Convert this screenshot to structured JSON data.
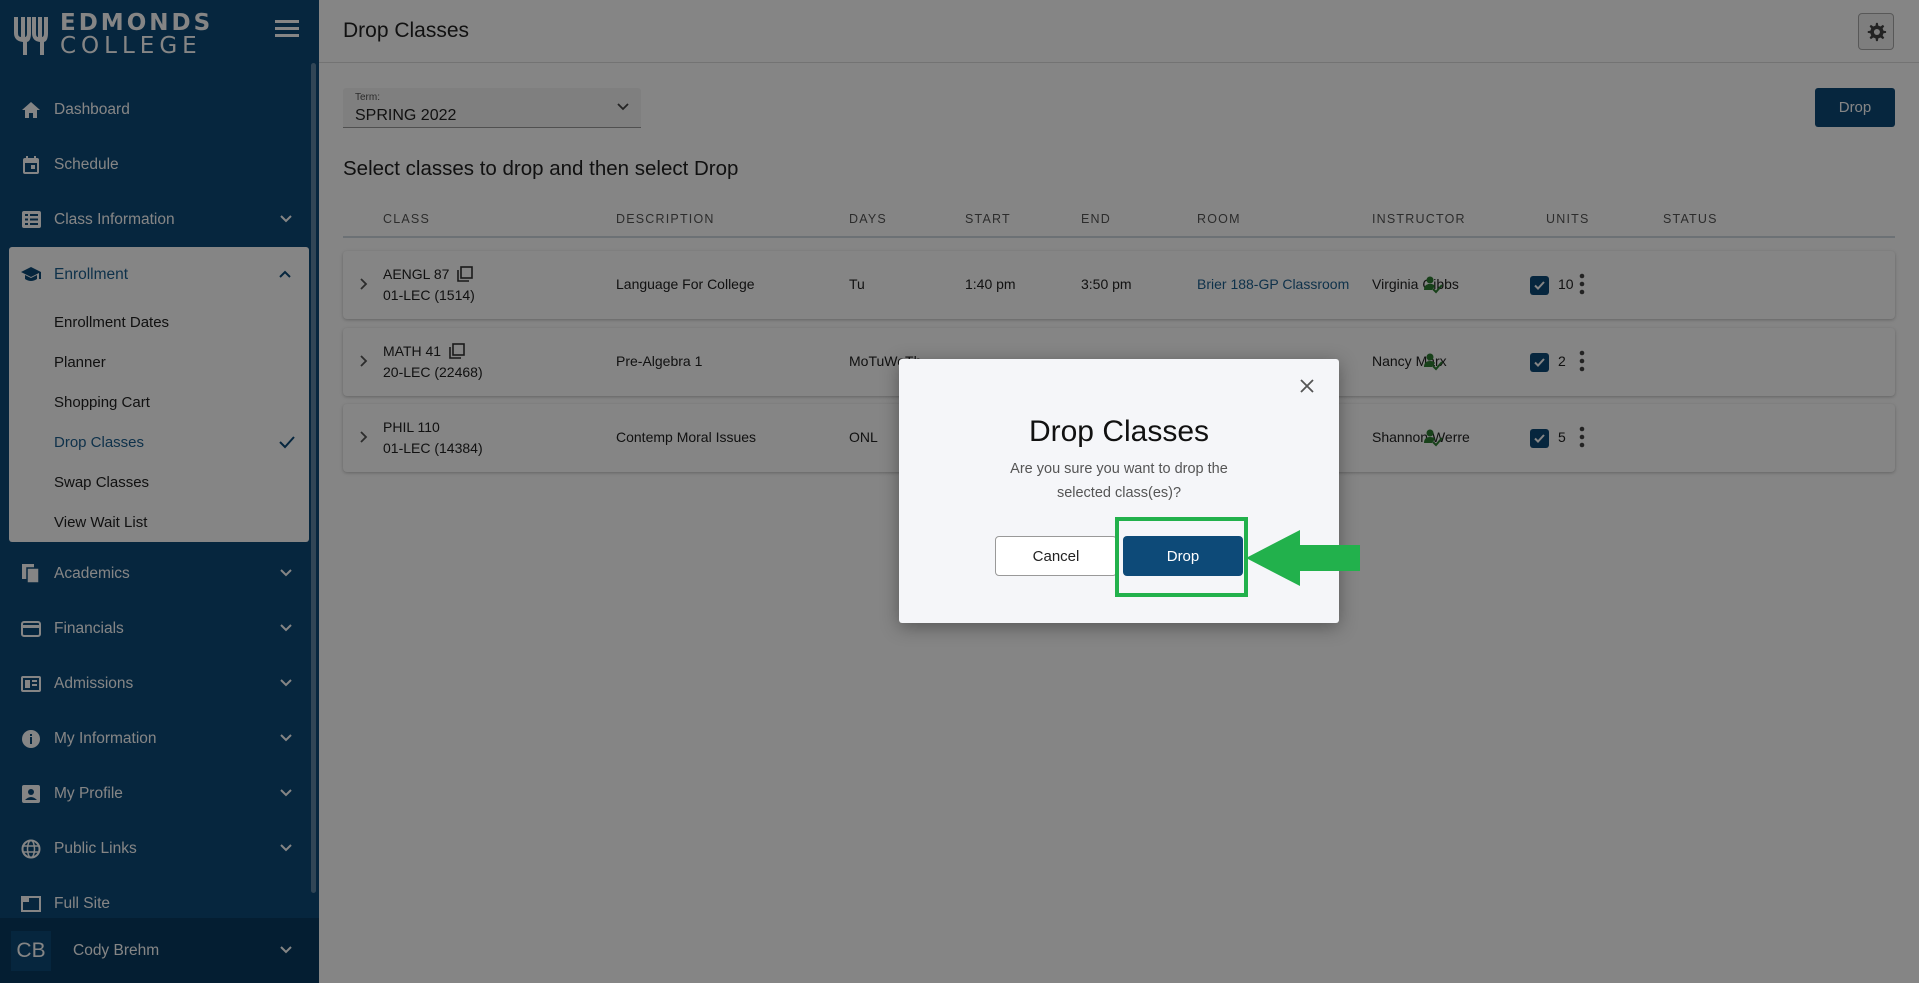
{
  "app": {
    "logo_line1": "EDMONDS",
    "logo_line2": "COLLEGE"
  },
  "sidebar": {
    "items": [
      {
        "label": "Dashboard",
        "icon": "home-icon"
      },
      {
        "label": "Schedule",
        "icon": "calendar-icon"
      },
      {
        "label": "Class Information",
        "icon": "class-list-icon"
      },
      {
        "label": "Enrollment",
        "icon": "graduation-cap-icon"
      },
      {
        "label": "Academics",
        "icon": "documents-icon"
      },
      {
        "label": "Financials",
        "icon": "credit-card-icon"
      },
      {
        "label": "Admissions",
        "icon": "newspaper-icon"
      },
      {
        "label": "My Information",
        "icon": "info-icon"
      },
      {
        "label": "My Profile",
        "icon": "profile-card-icon"
      },
      {
        "label": "Public Links",
        "icon": "globe-icon"
      },
      {
        "label": "Full Site",
        "icon": "window-icon"
      }
    ],
    "enrollment_sub": [
      {
        "label": "Enrollment Dates"
      },
      {
        "label": "Planner"
      },
      {
        "label": "Shopping Cart"
      },
      {
        "label": "Drop Classes"
      },
      {
        "label": "Swap Classes"
      },
      {
        "label": "View Wait List"
      }
    ],
    "user": {
      "initials": "CB",
      "name": "Cody Brehm"
    }
  },
  "header": {
    "title": "Drop Classes"
  },
  "term": {
    "label": "Term:",
    "value": "SPRING 2022"
  },
  "toolbar": {
    "drop_label": "Drop"
  },
  "instructions": "Select classes to drop and then select Drop",
  "table": {
    "columns": [
      "CLASS",
      "DESCRIPTION",
      "DAYS",
      "START",
      "END",
      "ROOM",
      "INSTRUCTOR",
      "UNITS",
      "STATUS"
    ],
    "rows": [
      {
        "course": "AENGL 87",
        "section": "01-LEC (1514)",
        "description": "Language For College",
        "days": "Tu",
        "start": "1:40 pm",
        "end": "3:50 pm",
        "room": "Brier 188-GP Classroom",
        "instructor": "Virginia Gibbs",
        "units": "10"
      },
      {
        "course": "MATH 41",
        "section": "20-LEC (22468)",
        "description": "Pre-Algebra 1",
        "days": "MoTuWeTh",
        "start": "",
        "end": "",
        "room": "",
        "instructor": "Nancy Marx",
        "units": "2"
      },
      {
        "course": "PHIL 110",
        "section": "01-LEC (14384)",
        "description": "Contemp Moral Issues",
        "days": "ONL",
        "start": "",
        "end": "",
        "room": "",
        "instructor": "Shannon Werre",
        "units": "5"
      }
    ]
  },
  "modal": {
    "title": "Drop Classes",
    "message": "Are you sure you want to drop the selected class(es)?",
    "cancel_label": "Cancel",
    "confirm_label": "Drop"
  },
  "colors": {
    "brand": "#0d4a78",
    "annotation": "#22b14c",
    "status_ok": "#2e7d32"
  }
}
